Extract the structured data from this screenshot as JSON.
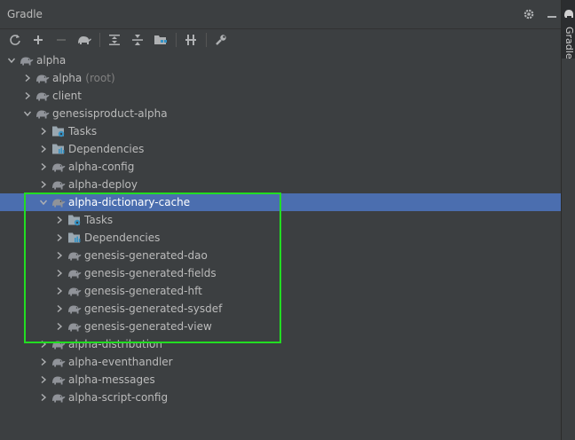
{
  "panel": {
    "title": "Gradle"
  },
  "side_tab": {
    "label": "Gradle"
  },
  "toolbar": {
    "buttons": [
      "refresh-icon",
      "add-icon",
      "remove-icon",
      "elephant-icon",
      "expand-all-icon",
      "collapse-all-icon",
      "group-modules-icon",
      "toggle-offline-icon",
      "settings-wrench-icon"
    ]
  },
  "tree": {
    "rows": [
      {
        "label": "alpha",
        "depth": 0,
        "expanded": true,
        "icon": "elephant-icon"
      },
      {
        "label": "alpha",
        "sub": "(root)",
        "depth": 1,
        "expanded": false,
        "icon": "elephant-icon"
      },
      {
        "label": "client",
        "depth": 1,
        "expanded": false,
        "icon": "elephant-icon"
      },
      {
        "label": "genesisproduct-alpha",
        "depth": 1,
        "expanded": true,
        "icon": "elephant-icon"
      },
      {
        "label": "Tasks",
        "depth": 2,
        "expanded": false,
        "icon": "tasks-folder-icon"
      },
      {
        "label": "Dependencies",
        "depth": 2,
        "expanded": false,
        "icon": "dependencies-icon"
      },
      {
        "label": "alpha-config",
        "depth": 2,
        "expanded": false,
        "icon": "elephant-icon"
      },
      {
        "label": "alpha-deploy",
        "depth": 2,
        "expanded": false,
        "icon": "elephant-icon"
      },
      {
        "label": "alpha-dictionary-cache",
        "depth": 2,
        "expanded": true,
        "icon": "elephant-icon",
        "selected": true
      },
      {
        "label": "Tasks",
        "depth": 3,
        "expanded": false,
        "icon": "tasks-folder-icon"
      },
      {
        "label": "Dependencies",
        "depth": 3,
        "expanded": false,
        "icon": "dependencies-icon"
      },
      {
        "label": "genesis-generated-dao",
        "depth": 3,
        "expanded": false,
        "icon": "elephant-icon"
      },
      {
        "label": "genesis-generated-fields",
        "depth": 3,
        "expanded": false,
        "icon": "elephant-icon"
      },
      {
        "label": "genesis-generated-hft",
        "depth": 3,
        "expanded": false,
        "icon": "elephant-icon"
      },
      {
        "label": "genesis-generated-sysdef",
        "depth": 3,
        "expanded": false,
        "icon": "elephant-icon"
      },
      {
        "label": "genesis-generated-view",
        "depth": 3,
        "expanded": false,
        "icon": "elephant-icon"
      },
      {
        "label": "alpha-distribution",
        "depth": 2,
        "expanded": false,
        "icon": "elephant-icon"
      },
      {
        "label": "alpha-eventhandler",
        "depth": 2,
        "expanded": false,
        "icon": "elephant-icon"
      },
      {
        "label": "alpha-messages",
        "depth": 2,
        "expanded": false,
        "icon": "elephant-icon"
      },
      {
        "label": "alpha-script-config",
        "depth": 2,
        "expanded": false,
        "icon": "elephant-icon"
      }
    ]
  },
  "colors": {
    "selection": "#4b6eaf",
    "highlight_box": "#22dd22",
    "panel_bg": "#3c3f41"
  }
}
